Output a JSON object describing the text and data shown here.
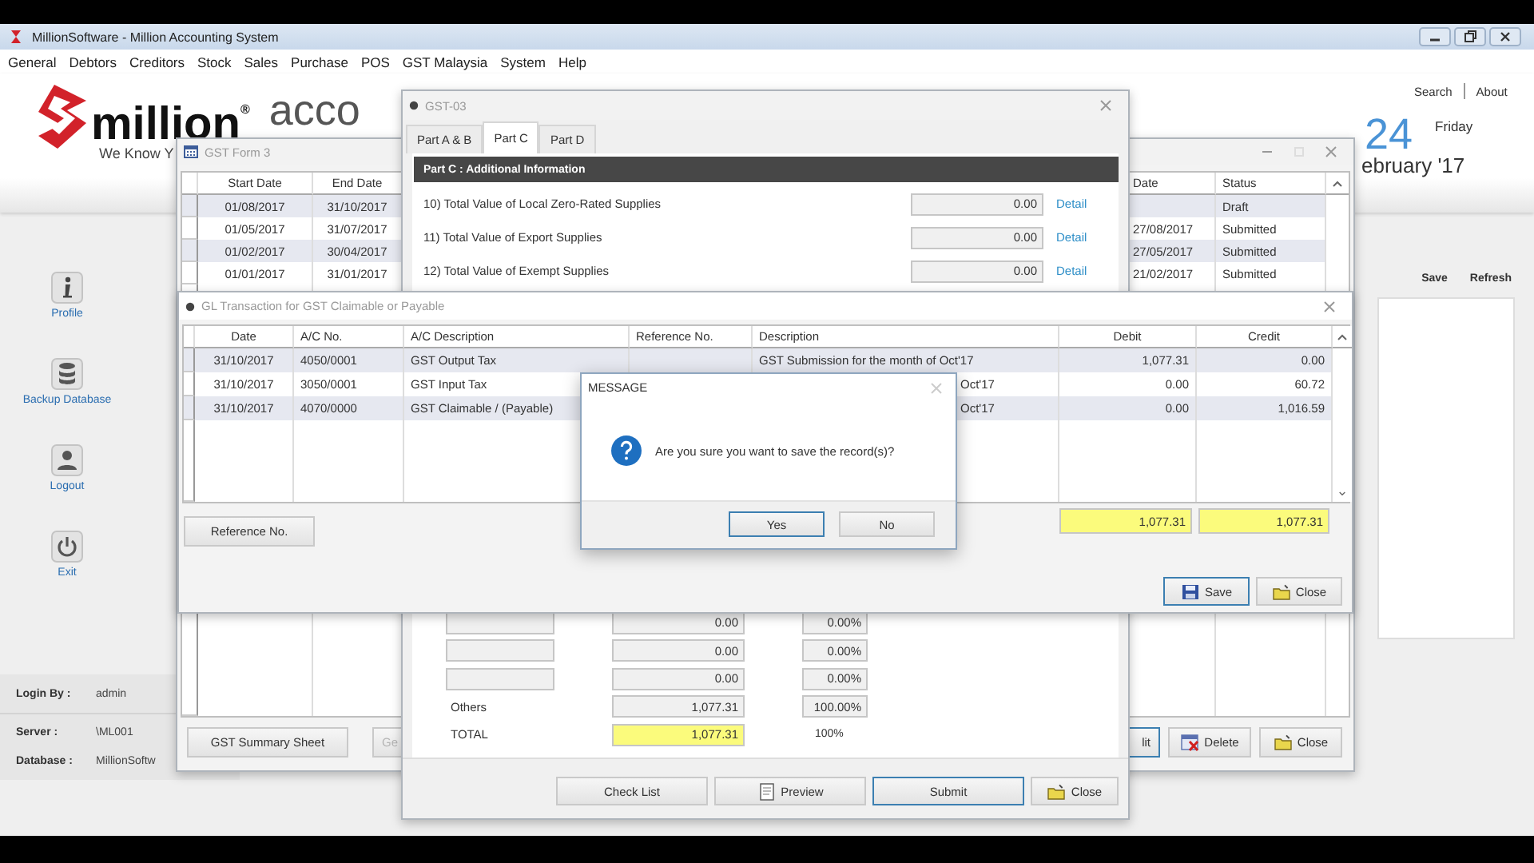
{
  "app": {
    "title": "MillionSoftware - Million Accounting System"
  },
  "menu": [
    "General",
    "Debtors",
    "Creditors",
    "Stock",
    "Sales",
    "Purchase",
    "POS",
    "GST Malaysia",
    "System",
    "Help"
  ],
  "header": {
    "brand": "million$^{®}$",
    "brand_suffix": "acco",
    "tagline": "We Know Y",
    "links": [
      "Search",
      "About"
    ],
    "day": "24",
    "weekday": "Friday",
    "month": "ebruary '17"
  },
  "sidebar": {
    "items": [
      {
        "label": "Profile"
      },
      {
        "label": "Backup Database"
      },
      {
        "label": "Logout"
      },
      {
        "label": "Exit"
      }
    ]
  },
  "session": [
    {
      "label": "Login By :",
      "value": "admin"
    },
    {
      "label": "Server :",
      "value": "\\ML001"
    },
    {
      "label": "Database :",
      "value": "MillionSoftw"
    }
  ],
  "side_panel": {
    "actions": [
      "Save",
      "Refresh"
    ]
  },
  "gst_form_3": {
    "title": "GST Form 3",
    "columns": [
      "Start Date",
      "End Date",
      "Date",
      "Status"
    ],
    "rows": [
      {
        "start": "01/08/2017",
        "end": "31/10/2017",
        "status": "Draft"
      },
      {
        "start": "01/05/2017",
        "end": "31/07/2017",
        "date": "27/08/2017",
        "status": "Submitted"
      },
      {
        "start": "01/02/2017",
        "end": "30/04/2017",
        "date": "27/05/2017",
        "status": "Submitted"
      },
      {
        "start": "01/01/2017",
        "end": "31/01/2017",
        "date": "21/02/2017",
        "status": "Submitted"
      }
    ],
    "left_buttons": [
      {
        "label": "GST Summary Sheet",
        "disabled": false
      },
      {
        "label": "Ge",
        "disabled": true
      }
    ],
    "right_buttons": [
      {
        "label": "lit",
        "focused": true
      },
      {
        "label": "Delete",
        "kind": "delete",
        "focused": false
      },
      {
        "label": "Close",
        "kind": "folder",
        "focused": false
      }
    ]
  },
  "gst_03": {
    "title": "GST-03",
    "tabs": [
      {
        "label": "Part A & B",
        "selected": false
      },
      {
        "label": "Part C",
        "selected": true
      },
      {
        "label": "Part D",
        "selected": false
      }
    ],
    "section": "Part C : Additional Information",
    "items": [
      {
        "label": "10) Total Value of Local Zero-Rated Supplies",
        "value": "0.00",
        "link": "Detail"
      },
      {
        "label": "11) Total Value of Export Supplies",
        "value": "0.00",
        "link": "Detail"
      },
      {
        "label": "12) Total Value of Exempt Supplies",
        "value": "0.00",
        "link": "Detail"
      }
    ],
    "breakdown": [
      {
        "kind": "input",
        "value": "0.00",
        "percent": "0.00%"
      },
      {
        "kind": "input",
        "value": "0.00",
        "percent": "0.00%"
      },
      {
        "kind": "input",
        "value": "0.00",
        "percent": "0.00%"
      },
      {
        "kind": "labeled",
        "label": "Others",
        "value": "1,077.31",
        "percent": "100.00%"
      },
      {
        "kind": "total",
        "label": "TOTAL",
        "value": "1,077.31",
        "percent": "100%"
      }
    ],
    "buttons": [
      {
        "label": "Check List",
        "focused": false
      },
      {
        "label": "Preview",
        "kind": "preview",
        "focused": false
      },
      {
        "label": "Submit",
        "focused": true
      },
      {
        "label": "Close",
        "kind": "folder",
        "focused": false
      }
    ]
  },
  "gl_transaction": {
    "title": "GL Transaction for GST Claimable or Payable",
    "columns": [
      "Date",
      "A/C No.",
      "A/C Description",
      "Reference No.",
      "Description",
      "Debit",
      "Credit"
    ],
    "rows": [
      {
        "date": "31/10/2017",
        "account": "4050/0001",
        "account_description": "GST Output Tax",
        "description": "GST Submission for the month of Oct'17",
        "covered": false,
        "debit": "1,077.31",
        "credit": "0.00"
      },
      {
        "date": "31/10/2017",
        "account": "3050/0001",
        "account_description": "GST Input Tax",
        "description": "Oct'17",
        "covered": true,
        "debit": "0.00",
        "credit": "60.72"
      },
      {
        "date": "31/10/2017",
        "account": "4070/0000",
        "account_description": "GST Claimable / (Payable)",
        "description": "Oct'17",
        "covered": true,
        "debit": "0.00",
        "credit": "1,016.59"
      }
    ],
    "totals": [
      "1,077.31",
      "1,077.31"
    ],
    "reference_button": "Reference No.",
    "buttons": [
      {
        "label": "Save",
        "kind": "save",
        "focused": true
      },
      {
        "label": "Close",
        "kind": "folder",
        "focused": false
      }
    ]
  },
  "message": {
    "title": "MESSAGE",
    "text": "Are you sure you want to save the record(s)?",
    "buttons": [
      {
        "label": "Yes",
        "focused": true
      },
      {
        "label": "No",
        "focused": false
      }
    ]
  }
}
